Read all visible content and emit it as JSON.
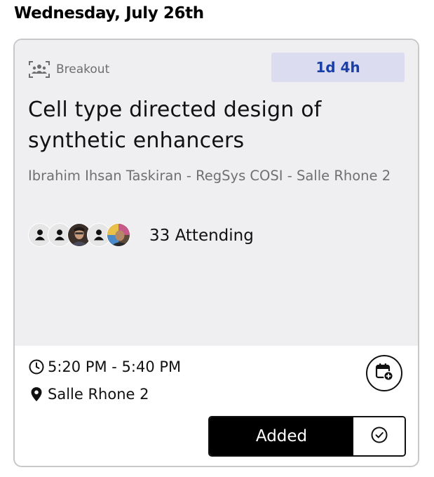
{
  "date_heading": "Wednesday, July 26th",
  "session": {
    "type_label": "Breakout",
    "type_icon": "group-icon",
    "countdown": "1d 4h",
    "title": "Cell type directed design of synthetic enhancers",
    "speakers": "Ibrahim Ihsan Taskiran - RegSys COSI - Salle Rhone 2",
    "attending": {
      "label": "33 Attending",
      "avatars": [
        "person-icon",
        "person-icon",
        "photo-avatar",
        "person-icon",
        "photo-avatar"
      ]
    },
    "time": "5:20 PM - 5:40 PM",
    "room": "Salle Rhone 2",
    "add_to_calendar_icon": "calendar-add-icon",
    "added_label": "Added",
    "check_icon": "check-circle-icon"
  },
  "colors": {
    "card_background": "#efeff1",
    "countdown_background": "#dcdcf1",
    "countdown_text": "#1a3fa8",
    "added_button": "#000000"
  }
}
